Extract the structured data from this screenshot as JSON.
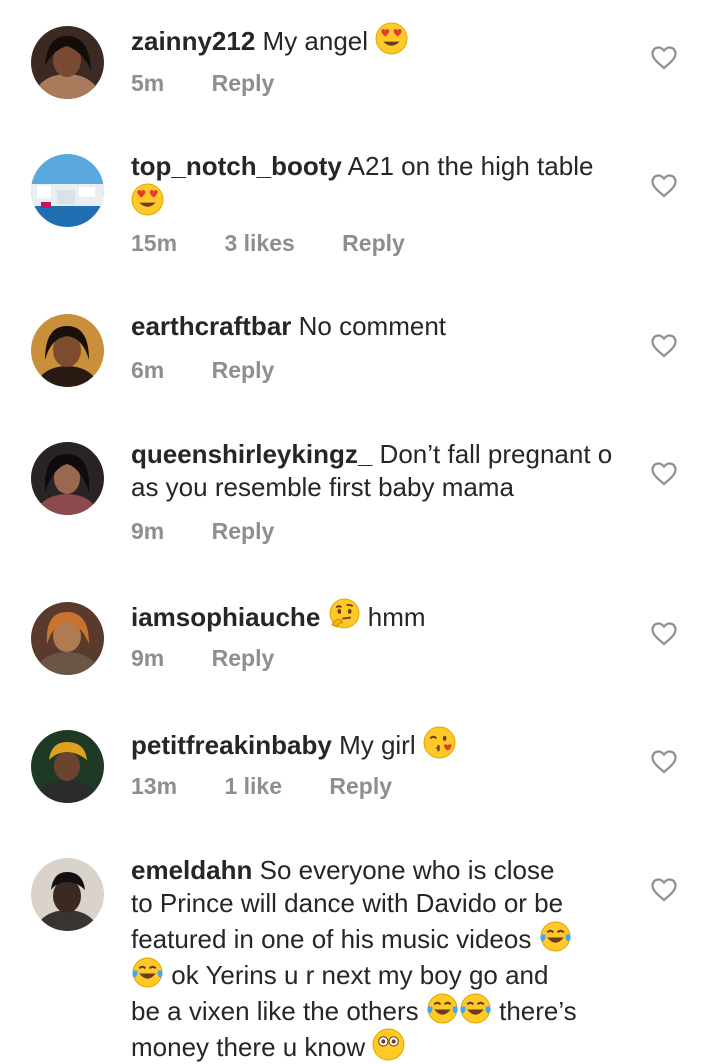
{
  "comments": [
    {
      "username": "zainny212",
      "text": "My angel",
      "emoji_after": "heart-eyes-emoji",
      "time": "5m",
      "likes": "",
      "reply": "Reply"
    },
    {
      "username": "top_notch_booty",
      "text": "A21 on the high table",
      "emoji_line2": "heart-eyes-emoji",
      "time": "15m",
      "likes": "3 likes",
      "reply": "Reply"
    },
    {
      "username": "earthcraftbar",
      "text": "No comment",
      "time": "6m",
      "likes": "",
      "reply": "Reply"
    },
    {
      "username": "queenshirleykingz_",
      "text": "Don’t fall pregnant o",
      "text_line2": "as you resemble first baby mama",
      "time": "9m",
      "likes": "",
      "reply": "Reply"
    },
    {
      "username": "iamsophiauche",
      "emoji_mid": "thinking-face-emoji",
      "text": "hmm",
      "time": "9m",
      "likes": "",
      "reply": "Reply"
    },
    {
      "username": "petitfreakinbaby",
      "text": "My girl",
      "emoji_after": "kissing-heart-emoji",
      "time": "13m",
      "likes": "1 like",
      "reply": "Reply"
    },
    {
      "username": "emeldahn",
      "text": "So everyone who is close",
      "line2": "to Prince will dance with Davido or be",
      "line3": "featured in one of his music videos",
      "line4": "ok Yerins u r next my boy go and",
      "line5": "be a vixen like the others",
      "line5b": "there’s",
      "line6": "money there u know"
    }
  ],
  "colors": {
    "text": "#262626",
    "meta": "#8e8e8e",
    "heart_outline": "#8e8e8e",
    "emoji_yellow": "#FFCA28",
    "emoji_heart": "#E53935"
  }
}
